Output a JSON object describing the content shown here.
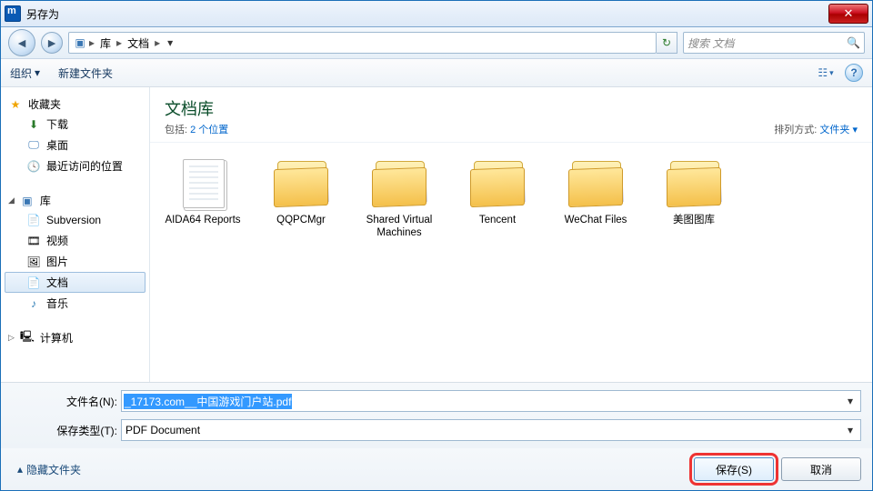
{
  "window": {
    "title": "另存为"
  },
  "breadcrumb": {
    "root_icon": "library",
    "seg1": "库",
    "seg2": "文档"
  },
  "search": {
    "placeholder": "搜索 文档"
  },
  "toolbar": {
    "organize": "组织",
    "new_folder": "新建文件夹"
  },
  "navpane": {
    "favorites": {
      "label": "收藏夹",
      "items": [
        {
          "label": "下载",
          "icon": "download"
        },
        {
          "label": "桌面",
          "icon": "desktop"
        },
        {
          "label": "最近访问的位置",
          "icon": "recent"
        }
      ]
    },
    "libraries": {
      "label": "库",
      "items": [
        {
          "label": "Subversion",
          "icon": "doc"
        },
        {
          "label": "视频",
          "icon": "video"
        },
        {
          "label": "图片",
          "icon": "pictures"
        },
        {
          "label": "文档",
          "icon": "doc",
          "selected": true
        },
        {
          "label": "音乐",
          "icon": "music"
        }
      ]
    },
    "computer": {
      "label": "计算机"
    }
  },
  "library_header": {
    "title": "文档库",
    "includes_prefix": "包括:",
    "includes_link": "2 个位置",
    "arrange_prefix": "排列方式:",
    "arrange_value": "文件夹"
  },
  "items": [
    {
      "name": "AIDA64 Reports",
      "type": "doc-folder"
    },
    {
      "name": "QQPCMgr",
      "type": "folder"
    },
    {
      "name": "Shared Virtual Machines",
      "type": "folder"
    },
    {
      "name": "Tencent",
      "type": "folder"
    },
    {
      "name": "WeChat Files",
      "type": "folder"
    },
    {
      "name": "美图图库",
      "type": "folder"
    }
  ],
  "form": {
    "filename_label": "文件名(N):",
    "filename_value": "_17173.com__中国游戏门户站.pdf",
    "filetype_label": "保存类型(T):",
    "filetype_value": "PDF Document"
  },
  "footer": {
    "hide_folders": "隐藏文件夹",
    "save": "保存(S)",
    "cancel": "取消"
  }
}
